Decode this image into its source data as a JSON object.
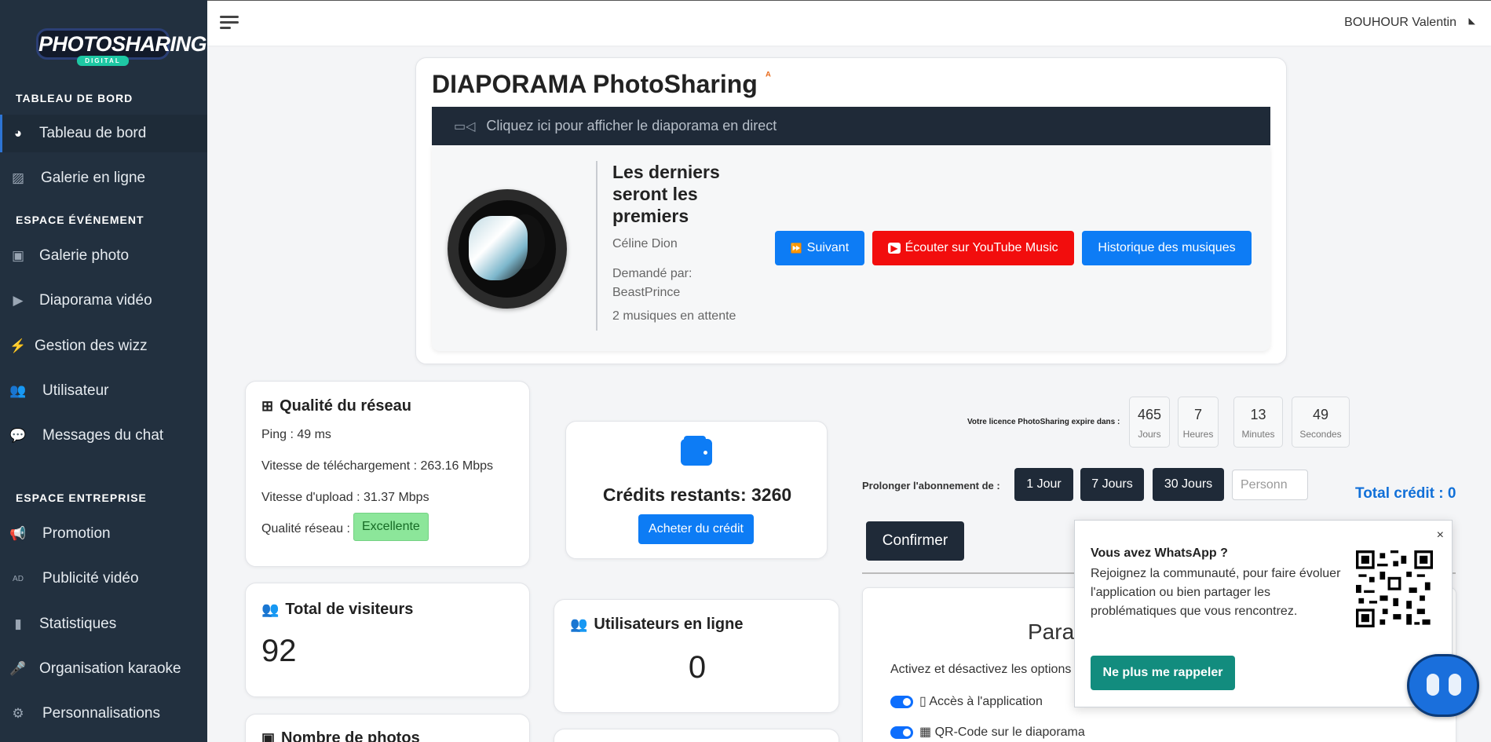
{
  "sidebar": {
    "logo_text": "PHOTOSHARING",
    "logo_sub": "DIGITAL",
    "sections": [
      {
        "title": "TABLEAU DE BORD"
      },
      {
        "title": "ESPACE ÉVÉNEMENT"
      },
      {
        "title": "ESPACE ENTREPRISE"
      }
    ],
    "items": [
      {
        "label": "Tableau de bord",
        "icon": "dashboard-icon"
      },
      {
        "label": "Galerie en ligne",
        "icon": "gallery-icon"
      },
      {
        "label": "Galerie photo",
        "icon": "image-icon"
      },
      {
        "label": "Diaporama vidéo",
        "icon": "play-icon"
      },
      {
        "label": "Gestion des wizz",
        "icon": "bolt-icon"
      },
      {
        "label": "Utilisateur",
        "icon": "users-icon"
      },
      {
        "label": "Messages du chat",
        "icon": "chat-icon"
      },
      {
        "label": "Promotion",
        "icon": "megaphone-icon"
      },
      {
        "label": "Publicité vidéo",
        "icon": "ad-icon"
      },
      {
        "label": "Statistiques",
        "icon": "chart-icon"
      },
      {
        "label": "Organisation karaoke",
        "icon": "mic-icon"
      },
      {
        "label": "Personnalisations",
        "icon": "gears-icon"
      }
    ]
  },
  "header": {
    "user": "BOUHOUR Valentin"
  },
  "diaporama": {
    "title": "DIAPORAMA PhotoSharing",
    "live_link": "Cliquez ici pour afficher le diaporama en direct",
    "song_title": "Les derniers seront les premiers",
    "artist": "Céline Dion",
    "requested_by": "Demandé par: BeastPrince",
    "waiting": "2 musiques en attente",
    "btn_next": "Suivant",
    "btn_youtube": "Écouter sur YouTube Music",
    "btn_history": "Historique des musiques"
  },
  "network": {
    "title": "Qualité du réseau",
    "ping": "Ping : 49 ms",
    "download": "Vitesse de téléchargement : 263.16 Mbps",
    "upload": "Vitesse d'upload : 31.37 Mbps",
    "quality_label": "Qualité réseau :",
    "quality_value": "Excellente"
  },
  "credits": {
    "remaining": "Crédits restants: 3260",
    "buy": "Acheter du crédit"
  },
  "visitors": {
    "title": "Total de visiteurs",
    "value": "92"
  },
  "online": {
    "title": "Utilisateurs en ligne",
    "value": "0"
  },
  "photos": {
    "title": "Nombre de photos"
  },
  "license": {
    "label": "Votre licence PhotoSharing expire dans :",
    "countdown": [
      {
        "value": "465",
        "unit": "Jours"
      },
      {
        "value": "7",
        "unit": "Heures"
      },
      {
        "value": "13",
        "unit": "Minutes"
      },
      {
        "value": "49",
        "unit": "Secondes"
      }
    ],
    "extend_label": "Prolonger l'abonnement de :",
    "options": [
      "1 Jour",
      "7 Jours",
      "30 Jours"
    ],
    "persons_placeholder": "Personn",
    "total": "Total crédit : 0",
    "confirm": "Confirmer"
  },
  "params": {
    "title": "Para",
    "desc": "Activez et désactivez les options",
    "options": [
      "Accès à l'application",
      "QR-Code sur le diaporama"
    ]
  },
  "whatsapp": {
    "title": "Vous avez WhatsApp ?",
    "text": "Rejoignez la communauté, pour faire évoluer l'application ou bien partager les problématiques que vous rencontrez.",
    "button": "Ne plus me rappeler",
    "close": "×"
  }
}
